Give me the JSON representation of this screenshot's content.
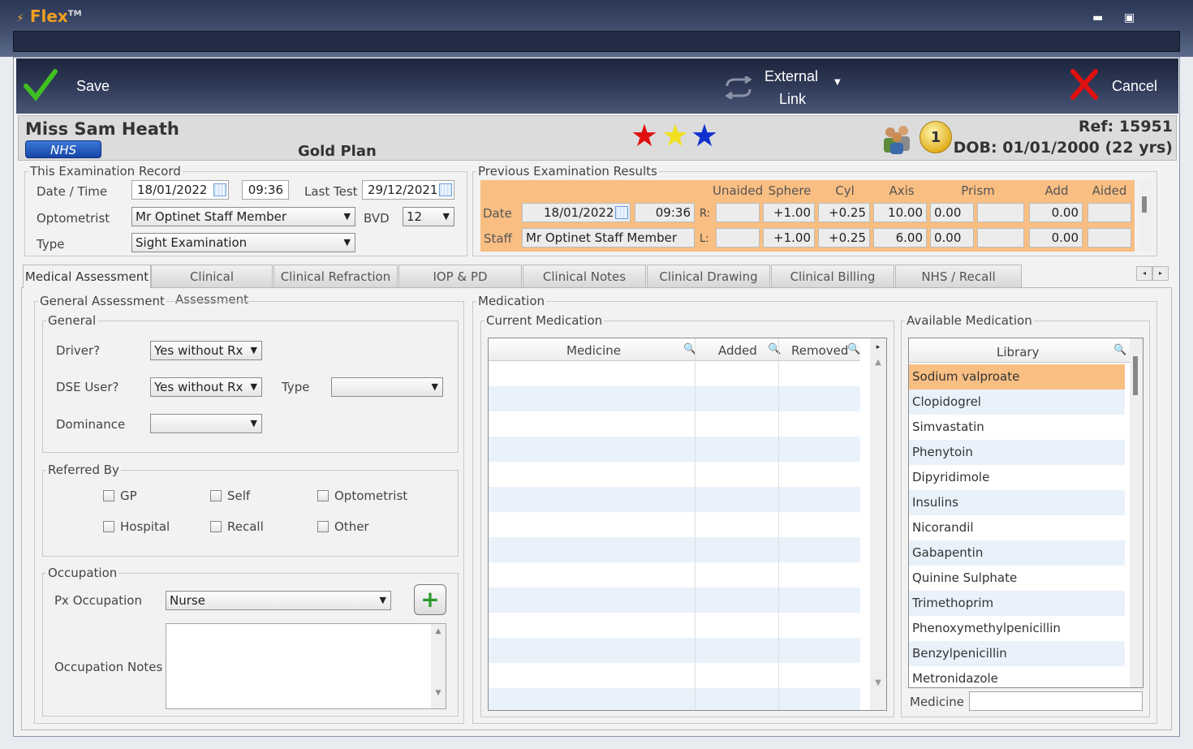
{
  "app": {
    "name": "Flex",
    "trademark": "TM"
  },
  "toolbar": {
    "save_label": "Save",
    "external_label_1": "External",
    "external_label_2": "Link",
    "cancel_label": "Cancel"
  },
  "patient": {
    "name": "Miss Sam Heath",
    "badge": "NHS",
    "plan": "Gold Plan",
    "ref": "Ref: 15951",
    "dob": "DOB: 01/01/2000 (22 yrs)",
    "coin": "1",
    "stars": [
      "#e01010",
      "#f0e020",
      "#1030d0"
    ]
  },
  "this_exam": {
    "legend": "This Examination Record",
    "date_time_label": "Date / Time",
    "date": "18/01/2022",
    "time": "09:36",
    "last_test_label": "Last Test",
    "last_test": "29/12/2021",
    "optometrist_label": "Optometrist",
    "optometrist": "Mr Optinet Staff Member",
    "bvd_label": "BVD",
    "bvd": "12",
    "type_label": "Type",
    "type": "Sight Examination"
  },
  "prev_exam": {
    "legend": "Previous Examination Results",
    "headers": [
      "Unaided",
      "Sphere",
      "Cyl",
      "Axis",
      "Prism",
      "Add",
      "Aided"
    ],
    "date_label": "Date",
    "date": "18/01/2022",
    "time": "09:36",
    "staff_label": "Staff",
    "staff": "Mr Optinet Staff Member",
    "r_label": "R:",
    "l_label": "L:",
    "r": {
      "sphere": "+1.00",
      "cyl": "+0.25",
      "axis": "10.00",
      "prism": "0.00",
      "add": "0.00"
    },
    "l": {
      "sphere": "+1.00",
      "cyl": "+0.25",
      "axis": "6.00",
      "prism": "0.00",
      "add": "0.00"
    }
  },
  "tabs": [
    "Medical Assessment",
    "Clinical Assessment",
    "Clinical Refraction",
    "IOP & PD",
    "Clinical Notes",
    "Clinical Drawing",
    "Clinical Billing",
    "NHS / Recall"
  ],
  "general_assessment": {
    "legend": "General Assessment",
    "general_legend": "General",
    "driver_label": "Driver?",
    "driver": "Yes without Rx",
    "dse_label": "DSE User?",
    "dse": "Yes without Rx",
    "type_label": "Type",
    "type": "",
    "dominance_label": "Dominance",
    "dominance": "",
    "referred_legend": "Referred By",
    "referred": [
      "GP",
      "Self",
      "Optometrist",
      "Hospital",
      "Recall",
      "Other"
    ],
    "occupation_legend": "Occupation",
    "px_occupation_label": "Px Occupation",
    "px_occupation": "Nurse",
    "occupation_notes_label": "Occupation Notes"
  },
  "medication": {
    "legend": "Medication",
    "current_legend": "Current Medication",
    "columns": [
      "Medicine",
      "Added",
      "Removed"
    ],
    "available_legend": "Available Medication",
    "library_header": "Library",
    "library": [
      "Sodium valproate",
      "Clopidogrel",
      "Simvastatin",
      "Phenytoin",
      "Dipyridimole",
      "Insulins",
      "Nicorandil",
      "Gabapentin",
      "Quinine Sulphate",
      "Trimethoprim",
      "Phenoxymethylpenicillin",
      "Benzylpenicillin",
      "Metronidazole"
    ],
    "selected_index": 0,
    "medicine_search_label": "Medicine",
    "medicine_search_value": ""
  }
}
